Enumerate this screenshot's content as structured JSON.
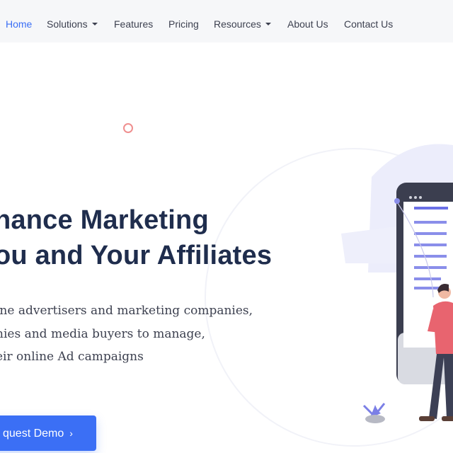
{
  "nav": {
    "items": [
      {
        "label": "Home",
        "active": true,
        "dropdown": false
      },
      {
        "label": "Solutions",
        "active": false,
        "dropdown": true
      },
      {
        "label": "Features",
        "active": false,
        "dropdown": false
      },
      {
        "label": "Pricing",
        "active": false,
        "dropdown": false
      },
      {
        "label": "Resources",
        "active": false,
        "dropdown": true
      },
      {
        "label": "About Us",
        "active": false,
        "dropdown": false
      },
      {
        "label": "Contact Us",
        "active": false,
        "dropdown": false
      }
    ]
  },
  "hero": {
    "headline_line1": "nance Marketing",
    "headline_line2": "ou and Your Affiliates",
    "sub_line1": "ine advertisers and marketing companies,",
    "sub_line2": "nies and media buyers to manage,",
    "sub_line3": "eir online Ad campaigns",
    "cta_label": "quest Demo",
    "cta_icon": "chevron-right-icon"
  },
  "colors": {
    "accent": "#3b6ff5",
    "heading": "#1f2d4d",
    "text": "#3d4150",
    "illustration_purple": "#7b7fe6",
    "illustration_pink": "#e8646f"
  }
}
